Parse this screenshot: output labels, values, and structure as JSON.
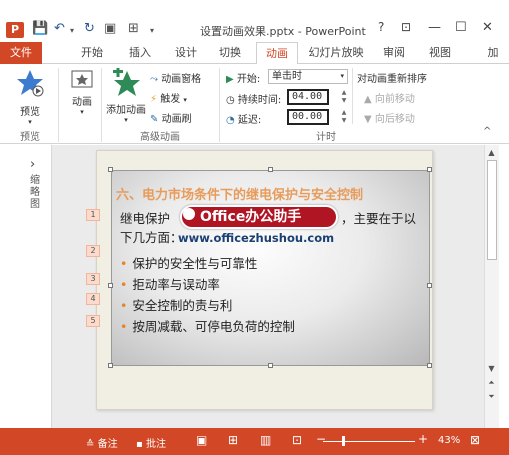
{
  "titlebar": {
    "app_logo": "P",
    "doc_title": "设置动画效果.pptx - PowerPoint",
    "help": "?",
    "ribbon_display": "⊡",
    "minimize": "—",
    "maximize": "☐",
    "close": "✕"
  },
  "tabs": [
    "文件",
    "开始",
    "插入",
    "设计",
    "切换",
    "动画",
    "幻灯片放映",
    "审阅",
    "视图",
    "加"
  ],
  "active_tab": "动画",
  "ribbon": {
    "preview": {
      "label": "预览",
      "group": "预览"
    },
    "animation": {
      "label": "动画"
    },
    "add_animation": {
      "label": "添加动画"
    },
    "animation_pane": "动画窗格",
    "trigger": "触发",
    "animation_painter": "动画刷",
    "advanced_group": "高级动画",
    "start_label": "开始:",
    "start_value": "单击时",
    "duration_label": "持续时间:",
    "duration_value": "04.00",
    "delay_label": "延迟:",
    "delay_value": "00.00",
    "reorder_label": "对动画重新排序",
    "move_earlier": "向前移动",
    "move_later": "向后移动",
    "timing_group": "计时"
  },
  "thumbs": {
    "toggle": "›",
    "label": "缩略图"
  },
  "slide": {
    "title": "六、电力市场条件下的继电保护与安全控制",
    "intro_line1_left": "继电保护",
    "intro_line1_right": "，主要在于以",
    "intro_line2": "下几方面：",
    "bullets": [
      "保护的安全性与可靠性",
      "拒动率与误动率",
      "安全控制的责与利",
      "按周减载、可停电负荷的控制"
    ],
    "animation_numbers": [
      "1",
      "2",
      "3",
      "4",
      "5"
    ]
  },
  "watermark": {
    "badge": "Office办公助手",
    "url": "www.officezhushou.com"
  },
  "statusbar": {
    "notes": "备注",
    "comments": "批注",
    "zoom": "43%"
  }
}
